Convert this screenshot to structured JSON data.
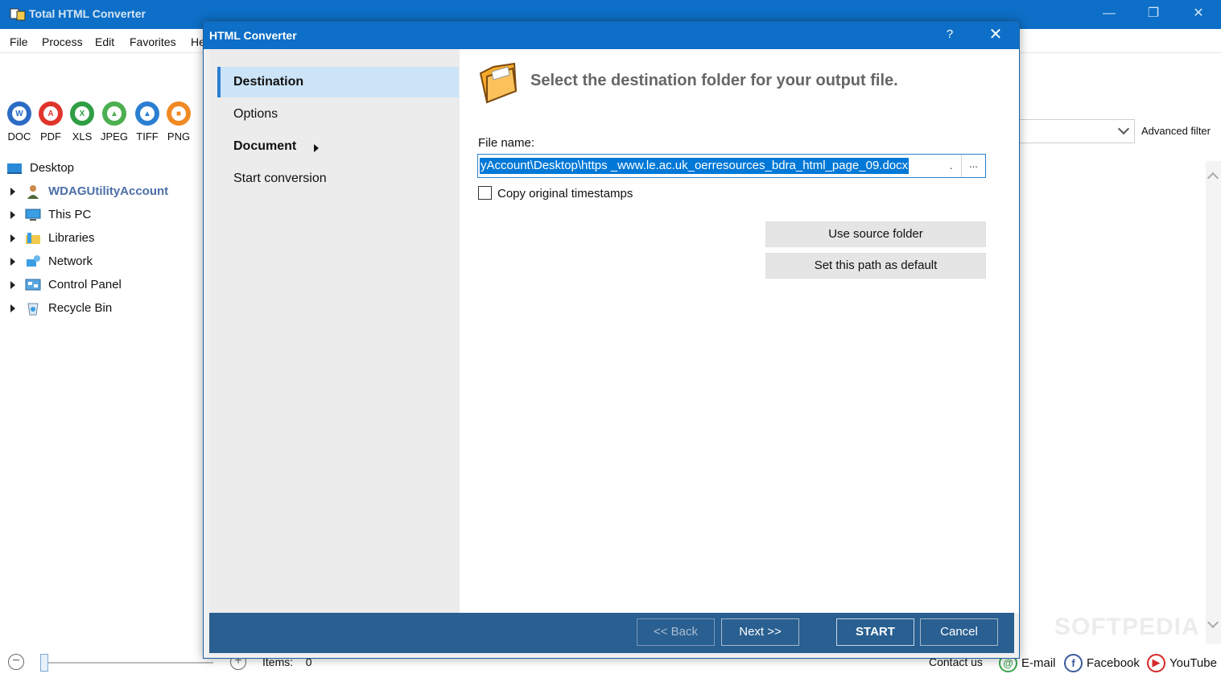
{
  "main_window": {
    "title": "Total HTML Converter",
    "menu": [
      "File",
      "Process",
      "Edit",
      "Favorites",
      "He"
    ],
    "format_buttons": [
      {
        "label": "DOC",
        "icon": "word-icon",
        "color": "#2b6cc4"
      },
      {
        "label": "PDF",
        "icon": "pdf-icon",
        "color": "#e0352b"
      },
      {
        "label": "XLS",
        "icon": "excel-icon",
        "color": "#2f9e44"
      },
      {
        "label": "JPEG",
        "icon": "jpeg-image-icon",
        "color": "#4caf50"
      },
      {
        "label": "TIFF",
        "icon": "tiff-image-icon",
        "color": "#2b7fd0"
      },
      {
        "label": "PNG",
        "icon": "png-image-icon",
        "color": "#f08a24"
      }
    ],
    "tree": {
      "root": "Desktop",
      "items": [
        "WDAGUtilityAccount",
        "This PC",
        "Libraries",
        "Network",
        "Control Panel",
        "Recycle Bin"
      ]
    },
    "advanced_filter": "Advanced filter",
    "status": {
      "items_label": "Items:",
      "items_count": "0",
      "contact": "Contact us",
      "email": "E-mail",
      "facebook": "Facebook",
      "youtube": "YouTube"
    },
    "watermark": "SOFTPEDIA"
  },
  "dialog": {
    "title": "HTML Converter",
    "help": "?",
    "nav": {
      "destination": "Destination",
      "options": "Options",
      "document": "Document",
      "start": "Start conversion"
    },
    "heading": "Select the destination folder for your output file.",
    "file_name_label": "File name:",
    "file_name_value": "yAccount\\Desktop\\https _www.le.ac.uk_oerresources_bdra_html_page_09.docx",
    "browse_label": "...",
    "copy_timestamps_label": "Copy original timestamps",
    "copy_timestamps_checked": false,
    "use_source_folder": "Use source folder",
    "set_default": "Set this path as default",
    "footer": {
      "back": "<< Back",
      "next": "Next >>",
      "start": "START",
      "cancel": "Cancel"
    }
  },
  "colors": {
    "titlebar": "#0d6fc7",
    "footer": "#295f91",
    "selection": "#0078d7",
    "nav_active": "#cce4f7"
  }
}
